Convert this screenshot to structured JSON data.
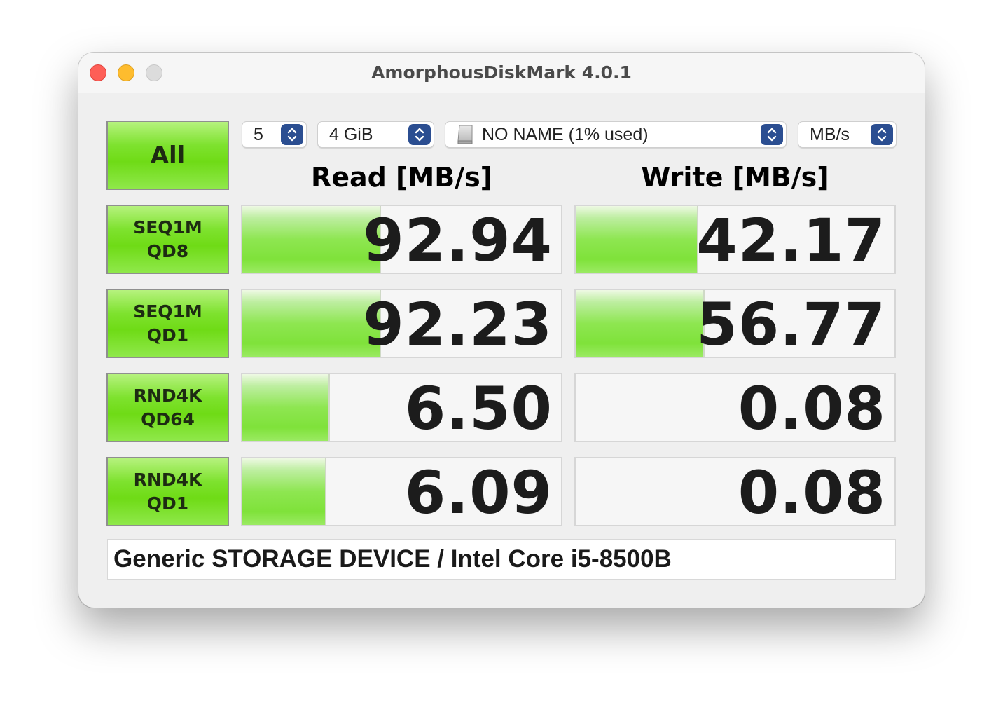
{
  "window": {
    "title": "AmorphousDiskMark 4.0.1"
  },
  "controls": {
    "all_label": "All",
    "count": "5",
    "size": "4 GiB",
    "drive": "NO NAME (1% used)",
    "unit": "MB/s"
  },
  "headers": {
    "read": "Read [MB/s]",
    "write": "Write [MB/s]"
  },
  "tests": [
    {
      "line1": "SEQ1M",
      "line2": "QD8",
      "read": "92.94",
      "read_fill": 0.43,
      "write": "42.17",
      "write_fill": 0.38
    },
    {
      "line1": "SEQ1M",
      "line2": "QD1",
      "read": "92.23",
      "read_fill": 0.43,
      "write": "56.77",
      "write_fill": 0.4
    },
    {
      "line1": "RND4K",
      "line2": "QD64",
      "read": "6.50",
      "read_fill": 0.27,
      "write": "0.08",
      "write_fill": 0
    },
    {
      "line1": "RND4K",
      "line2": "QD1",
      "read": "6.09",
      "read_fill": 0.26,
      "write": "0.08",
      "write_fill": 0
    }
  ],
  "footer": {
    "info": "Generic STORAGE DEVICE / Intel Core i5-8500B"
  }
}
